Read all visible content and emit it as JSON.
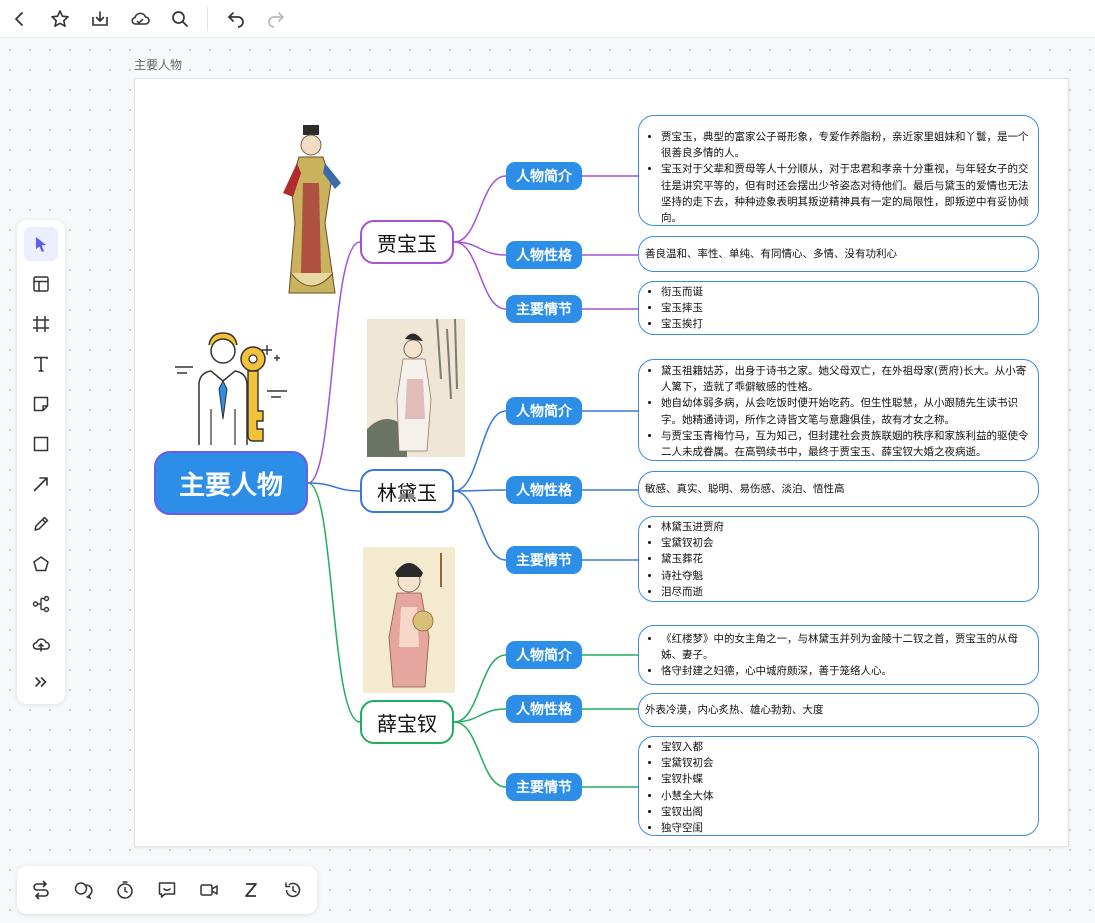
{
  "toolbar": {
    "icons": [
      "back-icon",
      "star-icon",
      "download-icon",
      "cloud-icon",
      "search-icon",
      "undo-icon",
      "redo-icon"
    ]
  },
  "board": {
    "title": "主要人物"
  },
  "mindmap": {
    "root": "主要人物",
    "characters": [
      {
        "name": "贾宝玉",
        "color": "#a552d6",
        "intro_label": "人物简介",
        "intro": [
          "贾宝玉，典型的富家公子哥形象，专爱作养脂粉，亲近家里姐妹和丫鬟，是一个很善良多情的人。",
          "宝玉对于父辈和贾母等人十分顺从，对于忠君和孝亲十分重视，与年轻女子的交往是讲究平等的，但有时还会摆出少爷姿态对待他们。最后与黛玉的爱情也无法坚持的走下去，种种迹象表明其叛逆精神具有一定的局限性，即叛逆中有妥协倾向。"
        ],
        "personality_label": "人物性格",
        "personality": "善良温和、率性、单纯、有同情心、多情、没有功利心",
        "plot_label": "主要情节",
        "plot": [
          "衔玉而诞",
          "宝玉摔玉",
          "宝玉挨打"
        ]
      },
      {
        "name": "林黛玉",
        "color": "#3a78d8",
        "intro_label": "人物简介",
        "intro": [
          "黛玉祖籍姑苏，出身于诗书之家。她父母双亡，在外祖母家(贾府)长大。从小寄人篱下，造就了乖僻敏感的性格。",
          "她自幼体弱多病，从会吃饭时便开始吃药。但生性聪慧，从小跟随先生读书识字。她精通诗词，所作之诗皆文笔与意趣俱佳，故有才女之称。",
          "与贾宝玉青梅竹马，互为知己，但封建社会贵族联姻的秩序和家族利益的驱使令二人未成眷属。在高鹗续书中，最终于贾宝玉、薛宝钗大婚之夜病逝。"
        ],
        "personality_label": "人物性格",
        "personality": "敏感、真实、聪明、易伤感、淡泊、悟性高",
        "plot_label": "主要情节",
        "plot": [
          "林黛玉进贾府",
          "宝黛钗初会",
          "黛玉葬花",
          "诗社夺魁",
          "泪尽而逝"
        ]
      },
      {
        "name": "薛宝钗",
        "color": "#1fae5b",
        "intro_label": "人物简介",
        "intro": [
          "《红楼梦》中的女主角之一，与林黛玉并列为金陵十二钗之首，贾宝玉的从母姊、妻子。",
          "恪守封建之妇德，心中城府颇深，善于笼络人心。"
        ],
        "personality_label": "人物性格",
        "personality": "外表冷漠，内心炙热、雄心勃勃、大度",
        "plot_label": "主要情节",
        "plot": [
          "宝钗入都",
          "宝黛钗初会",
          "宝钗扑蝶",
          "小慧全大体",
          "宝钗出阁",
          "独守空闺"
        ]
      }
    ]
  },
  "left_tools": [
    "select-icon",
    "template-icon",
    "frame-icon",
    "text-icon",
    "sticky-note-icon",
    "rectangle-icon",
    "arrow-line-icon",
    "pen-icon",
    "polygon-icon",
    "mindmap-icon",
    "upload-icon",
    "more-icon"
  ],
  "bottom_tools": [
    "flow-icon",
    "comment-icon",
    "timer-icon",
    "feedback-icon",
    "video-icon",
    "sleep-icon",
    "history-icon"
  ],
  "colors": {
    "accent": "#2d8ee8",
    "root_border": "#6c5ce7",
    "box_border": "#3a8ee0"
  }
}
